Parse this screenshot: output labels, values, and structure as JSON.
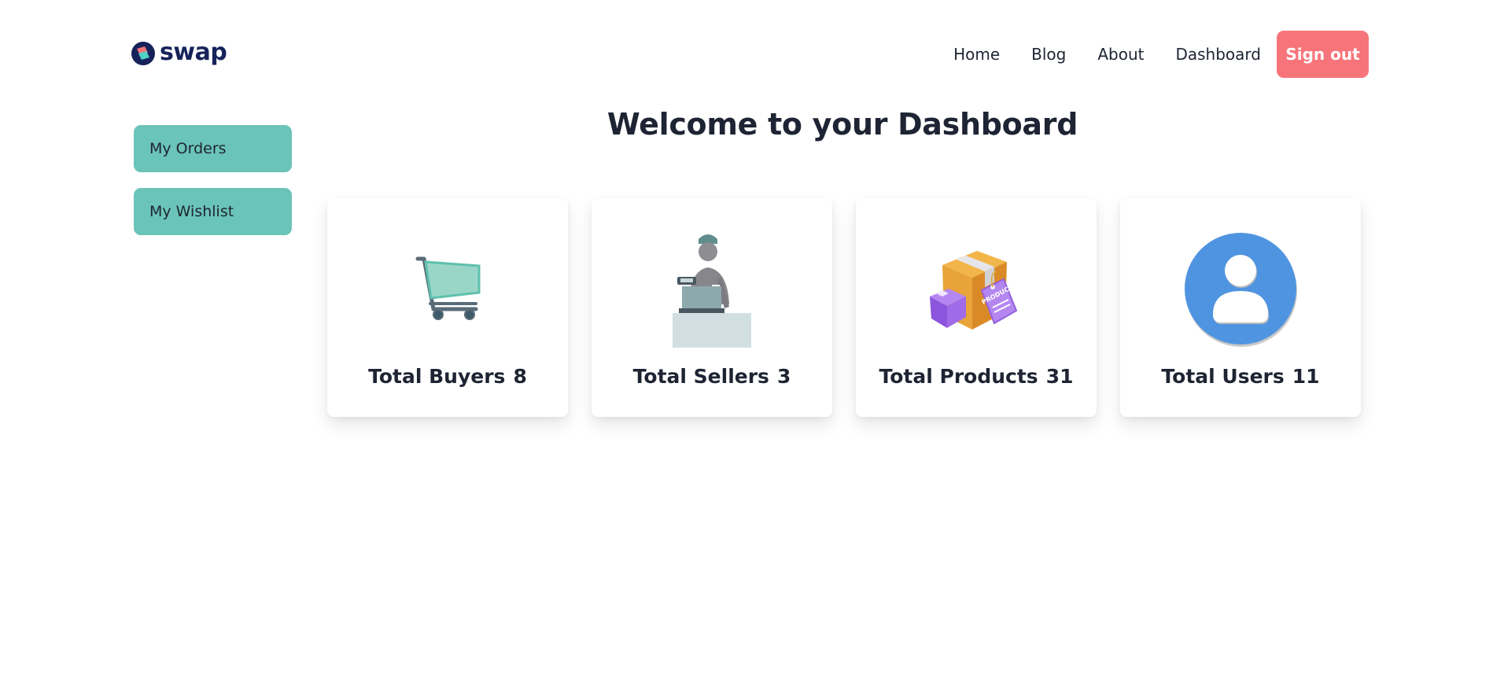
{
  "header": {
    "logo_text": "swap",
    "nav": [
      {
        "label": "Home"
      },
      {
        "label": "Blog"
      },
      {
        "label": "About"
      },
      {
        "label": "Dashboard"
      }
    ],
    "signout_label": "Sign out",
    "colors": {
      "signout": "#f7757a",
      "brand": "#16235a"
    }
  },
  "sidebar": {
    "items": [
      {
        "label": "My Orders"
      },
      {
        "label": "My Wishlist"
      }
    ],
    "color": "#6bc4b8"
  },
  "main": {
    "title": "Welcome to your Dashboard",
    "stats": [
      {
        "label": "Total Buyers",
        "value": "8",
        "icon": "shopping-cart-icon"
      },
      {
        "label": "Total Sellers",
        "value": "3",
        "icon": "cashier-icon"
      },
      {
        "label": "Total Products",
        "value": "31",
        "icon": "product-box-icon"
      },
      {
        "label": "Total Users",
        "value": "11",
        "icon": "user-avatar-icon"
      }
    ],
    "product_tag_text": "PRODUCT"
  }
}
